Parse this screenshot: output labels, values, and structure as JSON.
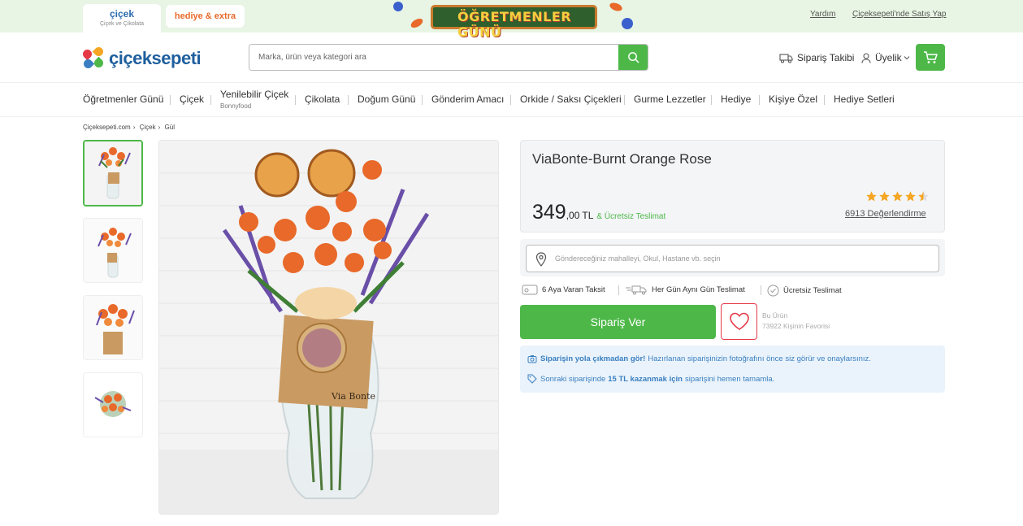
{
  "topbar": {
    "tab_cicek": "çiçek",
    "tab_cicek_sub": "Çiçek ve Çikolata",
    "tab_hediye": "hediye & extra",
    "banner_text": "ÖĞRETMENLER GÜNÜ",
    "link_help": "Yardım",
    "link_sell": "Çiçeksepeti'nde Satış Yap"
  },
  "header": {
    "logo_text": "çiçeksepeti",
    "search_placeholder": "Marka, ürün veya kategori ara",
    "order_tracking": "Sipariş Takibi",
    "membership": "Üyelik"
  },
  "nav": {
    "items": [
      {
        "label": "Öğretmenler Günü"
      },
      {
        "label": "Çiçek"
      },
      {
        "label": "Yenilebilir Çiçek",
        "sub": "Bonnyfood"
      },
      {
        "label": "Çikolata"
      },
      {
        "label": "Doğum Günü"
      },
      {
        "label": "Gönderim Amacı"
      },
      {
        "label": "Orkide / Saksı Çiçekleri"
      },
      {
        "label": "Gurme Lezzetler"
      },
      {
        "label": "Hediye"
      },
      {
        "label": "Kişiye Özel"
      },
      {
        "label": "Hediye Setleri"
      }
    ]
  },
  "breadcrumb": [
    "Çiçeksepeti.com",
    "Çiçek",
    "Gül"
  ],
  "product": {
    "title": "ViaBonte-Burnt Orange Rose",
    "price_main": "349",
    "price_decimal": ",00",
    "currency": "TL",
    "free_delivery": "& Ücretsiz Teslimat",
    "rating": 4.5,
    "reviews": "6913 Değerlendirme",
    "address_placeholder": "Göndereceğiniz mahalleyi, Okul, Hastane vb. seçin",
    "features": [
      "6 Aya Varan Taksit",
      "Her Gün Aynı Gün Teslimat",
      "Ücretsiz Teslimat"
    ],
    "order_button": "Sipariş Ver",
    "fav_line1": "Bu Ürün",
    "fav_line2": "73922 Kişinin Favorisi",
    "notice1_bold": "Siparişin yola çıkmadan gör!",
    "notice1_rest": "Hazırlanan siparişinizin fotoğrafını önce siz görür ve onaylarsınız.",
    "notice2_a": "Sonraki siparişinde",
    "notice2_b": "15 TL kazanmak için",
    "notice2_c": "siparişini hemen tamamla."
  },
  "colors": {
    "brand_green": "#4db848",
    "brand_blue": "#1f5f9e",
    "top_bg": "#e8f5e4",
    "notice_blue": "#3a7fc1",
    "star": "#f5a623",
    "fav_red": "#e63946"
  }
}
